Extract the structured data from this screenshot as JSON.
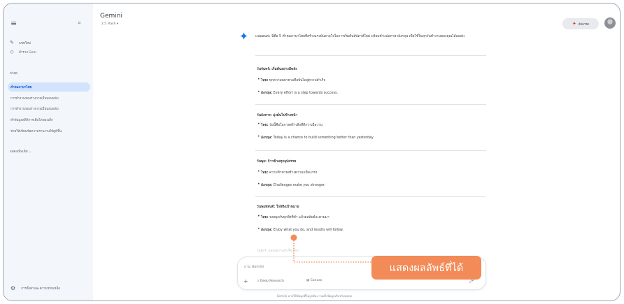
{
  "sidebar": {
    "new_chat_label": "แชทใหม่",
    "explore_gem_label": "สำรวจ Gem",
    "recent_heading": "ล่าสุด",
    "recent_items": [
      {
        "label": "คำคมภาษาไทย",
        "active": true
      },
      {
        "label": "การทำงานของร่างกายเมื่อนอนหลับ",
        "active": false
      },
      {
        "label": "การทำงานของร่างกายเมื่อนอนหลับ",
        "active": false
      },
      {
        "label": "ทำข้อมูลสถิติการเติบโตของเด็ก",
        "active": false
      },
      {
        "label": "ช่วยให้เขียนข้อความรายงานให้ดูดีขึ้น",
        "active": false
      }
    ],
    "show_more_label": "แสดงเพิ่มเติม ⌄",
    "settings_label": "การตั้งค่าและความช่วยเหลือ"
  },
  "header": {
    "title": "Gemini",
    "model": "2.5 Flash ▾",
    "upgrade_label": "อัปเกรด"
  },
  "response": {
    "intro": "แน่นอนค่ะ นี่คือ 5 คำคมภาษาไทยที่สร้างแรงบันดาลใจในการเริ่มต้นสัปดาห์ใหม่ พร้อมคำแปลภาษาอังกฤษ เพื่อใช้ในทุกวันทำงานของคุณได้เลยค่ะ",
    "days": [
      {
        "title": "วันจันทร์: เริ่มต้นอย่างมีพลัง",
        "thai_label": "ไทย:",
        "thai": "ทุกความพยายามคือบันไดสู่ความสำเร็จ",
        "eng_label": "อังกฤษ:",
        "eng": "Every effort is a step towards success."
      },
      {
        "title": "วันอังคาร: มุ่งมั่นไปข้างหน้า",
        "thai_label": "ไทย:",
        "thai": "วันนี้คือโอกาสสร้างสิ่งที่ดีกว่าเมื่อวาน",
        "eng_label": "อังกฤษ:",
        "eng": "Today is a chance to build something better than yesterday."
      },
      {
        "title": "วันพุธ: ก้าวข้ามทุกอุปสรรค",
        "thai_label": "ไทย:",
        "thai": "ความท้าทายสร้างความแข็งแกร่ง",
        "eng_label": "อังกฤษ:",
        "eng": "Challenges make you stronger."
      },
      {
        "title": "วันพฤหัสบดี: ใกล้ถึงเป้าหมาย",
        "thai_label": "ไทย:",
        "thai": "จงสนุกกับทุกสิ่งที่ทำ แล้วผลลัพธ์จะตามมา",
        "eng_label": "อังกฤษ:",
        "eng": "Enjoy what you do, and results will follow."
      }
    ],
    "fading_text": "วันศุกร์: ฉลองความสำเร็จเล็กๆ"
  },
  "input": {
    "placeholder": "ถาม Gemini",
    "deep_research_label": "Deep Research",
    "canvas_label": "Canvas"
  },
  "disclaimer": "Gemini อาจให้ข้อมูลที่ไม่ถูกต้อง รวมถึงข้อมูลเกี่ยวกับบุคคล",
  "annotation": {
    "label": "แสดงผลลัพธ์ที่ได้",
    "color": "#f28b58"
  },
  "colors": {
    "sidebar_bg": "#f3f6fb",
    "active_item_bg": "#d3e3fd",
    "gemini_blue": "#1a73e8"
  }
}
